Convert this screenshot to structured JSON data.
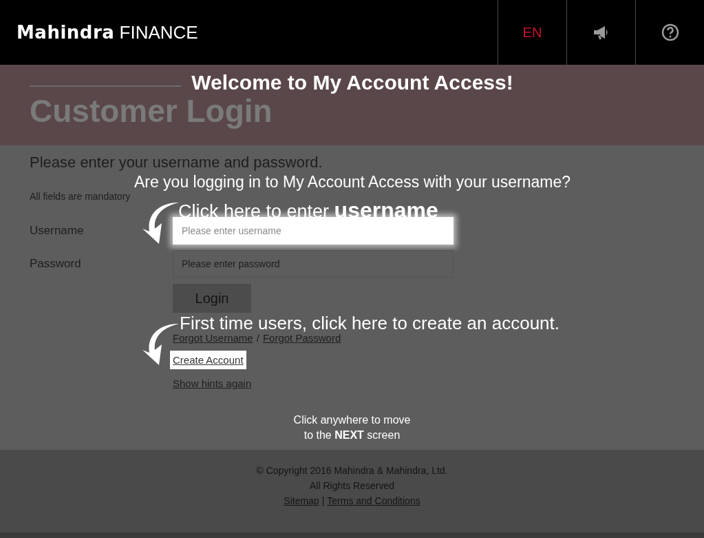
{
  "header": {
    "logo": {
      "brand": "Mahindra",
      "product": "FINANCE"
    },
    "language": "EN"
  },
  "page": {
    "title": "Customer Login",
    "instructions": "Please enter your username and password.",
    "mandatory_note": "All fields are mandatory",
    "fields": [
      {
        "label": "Username",
        "placeholder": "Please enter username",
        "highlighted": true
      },
      {
        "label": "Password",
        "placeholder": "Please enter password",
        "highlighted": false
      }
    ],
    "login_button": "Login",
    "links": [
      {
        "kind": "forgot",
        "text": "Forgot Username",
        "highlighted": false
      },
      {
        "kind": "separator",
        "text": "/"
      },
      {
        "kind": "forgot",
        "text": "Forgot Password",
        "highlighted": false
      }
    ],
    "create_account": {
      "text": "Create Account",
      "highlighted": true
    },
    "show_hints": "Show hints again"
  },
  "footer": {
    "copyright": "© Copyright 2016 Mahindra & Mahindra, Ltd.",
    "rights": "All Rights Reserved",
    "links": [
      "Sitemap",
      "Terms and Conditions"
    ],
    "separator": "|"
  },
  "overlay": {
    "title": "Welcome to My Account Access!",
    "question": "Are you logging in to My Account Access with your username?",
    "hints": [
      "Click here to enter **username**",
      "First time users, click here to create an account."
    ],
    "next_note": "Click anywhere to move\nto the **NEXT** screen"
  }
}
